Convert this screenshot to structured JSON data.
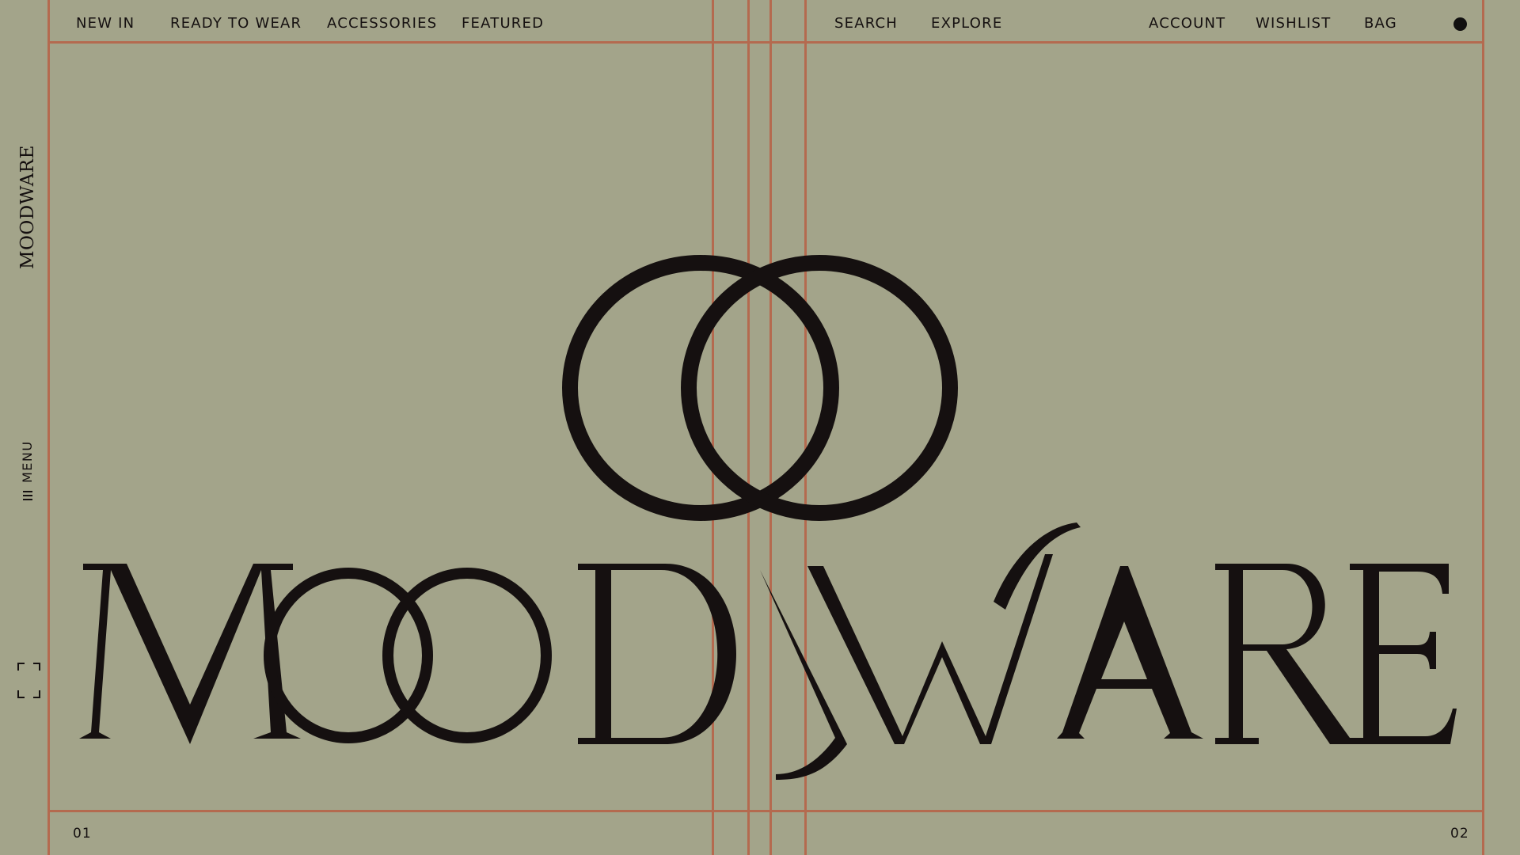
{
  "nav": {
    "left": [
      {
        "label": "NEW IN"
      },
      {
        "label": "READY TO WEAR"
      },
      {
        "label": "ACCESSORIES"
      },
      {
        "label": "FEATURED"
      }
    ],
    "center": [
      {
        "label": "SEARCH"
      },
      {
        "label": "EXPLORE"
      }
    ],
    "right": [
      {
        "label": "ACCOUNT"
      },
      {
        "label": "WISHLIST"
      },
      {
        "label": "BAG"
      }
    ]
  },
  "sidebar": {
    "logo": "MOODWARE",
    "menu_label": "MENU",
    "menu_icon": "hamburger-icon",
    "fullscreen_icon": "fullscreen-icon"
  },
  "hero": {
    "monogram": "OO",
    "wordmark": {
      "letters_before": "M",
      "letters_after": "D",
      "special": "W",
      "tail": "ARE"
    }
  },
  "footer": {
    "page_left": "01",
    "page_right": "02"
  },
  "colors": {
    "background": "#a3a48a",
    "ink": "#151010",
    "guide": "#b46a4f"
  }
}
